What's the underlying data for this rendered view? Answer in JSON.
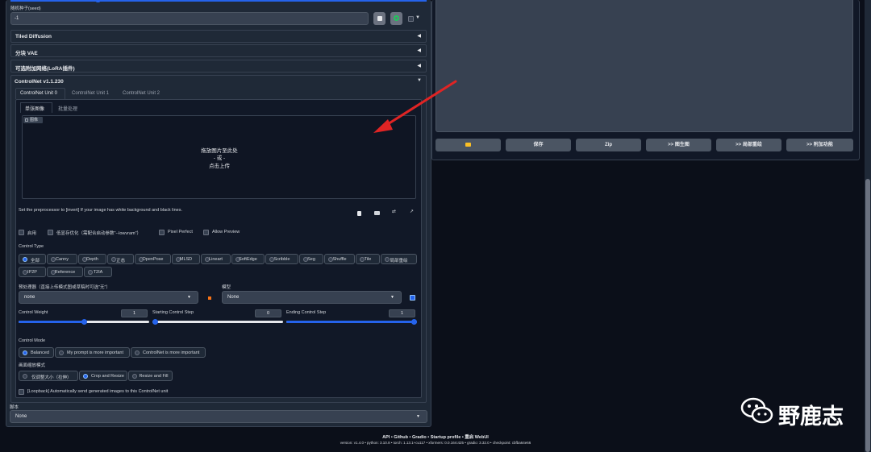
{
  "seed": {
    "label": "随机种子(seed)",
    "value": "-1"
  },
  "accordions": {
    "tiled": "Tiled Diffusion",
    "vae": "分块 VAE",
    "lora": "可选附加网络(LoRA插件)",
    "controlnet": "ControlNet v1.1.230"
  },
  "cn_tabs": [
    "ControlNet Unit 0",
    "ControlNet Unit 1",
    "ControlNet Unit 2"
  ],
  "img_tabs": [
    "单张图像",
    "批量处理"
  ],
  "upload": {
    "badge": "图像",
    "line1": "拖放图片至此处",
    "line2": "- 或 -",
    "line3": "点击上传"
  },
  "preprocessor_hint": "Set the preprocessor to [invert] If your image has white background and black lines.",
  "checkboxes": {
    "enable": "启用",
    "lowvram": "低显存优化（需配合启动参数\"--lowvram\"）",
    "pixel_perfect": "Pixel Perfect",
    "allow_preview": "Allow Preview"
  },
  "control_type": {
    "label": "Control Type",
    "options": [
      "全部",
      "Canny",
      "Depth",
      "正态",
      "OpenPose",
      "MLSD",
      "Lineart",
      "SoftEdge",
      "Scribble",
      "Seg",
      "Shuffle",
      "Tile",
      "局部重绘",
      "IP2P",
      "Reference",
      "T2IA"
    ],
    "selected": "全部"
  },
  "preprocessor": {
    "label": "预处理器（直接上传模式图或草稿时可选\"无\"）",
    "value": "none"
  },
  "model": {
    "label": "模型",
    "value": "None"
  },
  "sliders": {
    "weight": {
      "label": "Control Weight",
      "value": "1",
      "fraction": 0.5
    },
    "start": {
      "label": "Starting Control Step",
      "value": "0",
      "fraction": 0.0
    },
    "end": {
      "label": "Ending Control Step",
      "value": "1",
      "fraction": 1.0
    }
  },
  "control_mode": {
    "label": "Control Mode",
    "options": [
      "Balanced",
      "My prompt is more important",
      "ControlNet is more important"
    ],
    "selected": "Balanced"
  },
  "resize_mode": {
    "label": "画面缩放模式",
    "options": [
      "仅调整大小（拉伸）",
      "Crop and Resize",
      "Resize and Fill"
    ],
    "selected": "Crop and Resize"
  },
  "loopback": "[Loopback] Automatically send generated images to this ControlNet unit",
  "script": {
    "label": "脚本",
    "value": "None"
  },
  "output_buttons": {
    "save": "保存",
    "zip": "Zip",
    "img2img": ">> 图生图",
    "inpaint": ">> 局部重绘",
    "extras": ">> 附加功能"
  },
  "footer": {
    "links": "API  •  Github  •  Gradio  •  Startup profile  •  重启 WebUI",
    "versions": "version: v1.4.0  •  python: 3.10.8  •  torch: 1.13.1+cu117  •  xformers: 0.0.16rc425  •  gradio: 3.32.0  •  checkpoint: cbfba64e66"
  },
  "watermark": "野鹿志",
  "colors": {
    "bg": "#0b0f19",
    "panel": "#1f2937",
    "accent": "#2563eb",
    "arrow": "#e02424"
  }
}
